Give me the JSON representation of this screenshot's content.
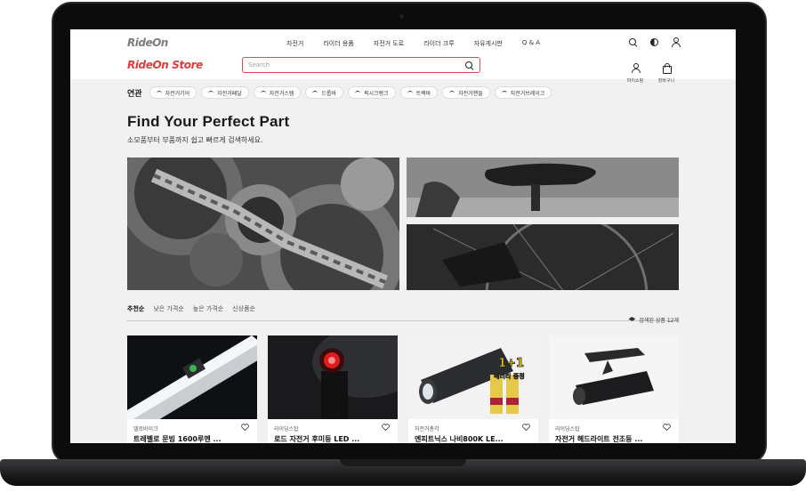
{
  "nav": {
    "logo": "RideOn",
    "items": [
      "자전거",
      "라이더 용품",
      "자전거 도로",
      "라이더 크루",
      "자유게시판",
      "Q & A"
    ]
  },
  "store": {
    "logo": "RideOn Store",
    "search_placeholder": "Search",
    "mypage_label": "마이쇼핑",
    "cart_label": "장바구니"
  },
  "related": {
    "label": "연관",
    "chips": [
      "자전거기어",
      "자전거페달",
      "자전거스템",
      "드롭바",
      "픽시크랭크",
      "트랙바",
      "자전거핸들",
      "자전거브레이크"
    ]
  },
  "hero": {
    "title": "Find Your Perfect Part",
    "subtitle": "소모품부터 부품까지 쉽고 빠르게 검색하세요."
  },
  "sort": {
    "options": [
      "추천순",
      "낮은 가격순",
      "높은 가격순",
      "신상품순"
    ],
    "active": "추천순",
    "result_count": "검색된 상품 12개"
  },
  "products": [
    {
      "shop": "델로바이크",
      "name": "트레벨로 문빔 1600루멘 ..."
    },
    {
      "shop": "라이딩스탑",
      "name": "로드 자전거 후미등 LED ..."
    },
    {
      "shop": "자전거총각",
      "name": "엔피트닉스 나비800K LE..."
    },
    {
      "shop": "라이딩스탑",
      "name": "자전거 헤드라이트 전조등 ..."
    }
  ],
  "badges": {
    "promo": "1+1",
    "promo_sub": "배터리 증정"
  },
  "colors": {
    "brand_red": "#e03b3b",
    "nav_gray": "#7c7c7c"
  }
}
